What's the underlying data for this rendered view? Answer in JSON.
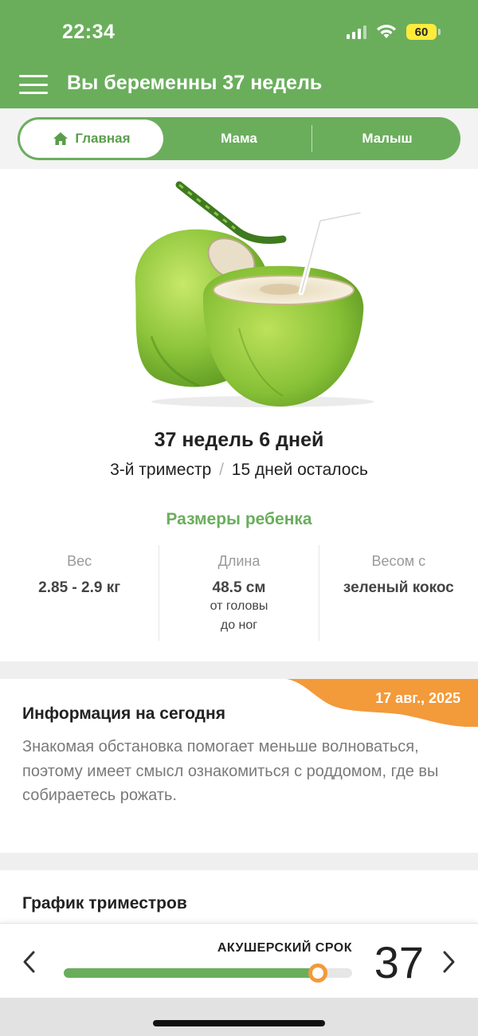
{
  "status_bar": {
    "time": "22:34",
    "battery": "60"
  },
  "header": {
    "title": "Вы беременны 37 недель"
  },
  "tabs": [
    {
      "label": "Главная",
      "active": true
    },
    {
      "label": "Мама",
      "active": false
    },
    {
      "label": "Малыш",
      "active": false
    }
  ],
  "pregnancy": {
    "weeks_days": "37 недель 6 дней",
    "trimester": "3-й триместр",
    "separator": "/",
    "remaining": "15 дней осталось"
  },
  "baby_size": {
    "title": "Размеры ребенка",
    "weight_label": "Вес",
    "weight_value": "2.85 - 2.9 кг",
    "length_label": "Длина",
    "length_value": "48.5 см",
    "length_note_1": "от головы",
    "length_note_2": "до ног",
    "compare_label": "Весом с",
    "compare_value": "зеленый кокос"
  },
  "info": {
    "date": "17 авг., 2025",
    "title": "Информация на сегодня",
    "text": "Знакомая обстановка помогает меньше волноваться, поэтому имеет смысл ознакомиться с роддомом, где вы собираетесь рожать."
  },
  "chart_section": {
    "title": "График триместров"
  },
  "bottom_bar": {
    "label": "АКУШЕРСКИЙ СРОК",
    "week": "37",
    "progress_percent": 88
  },
  "colors": {
    "accent": "#6aae5c",
    "orange": "#f39a3a",
    "battery": "#ffeb3b"
  }
}
